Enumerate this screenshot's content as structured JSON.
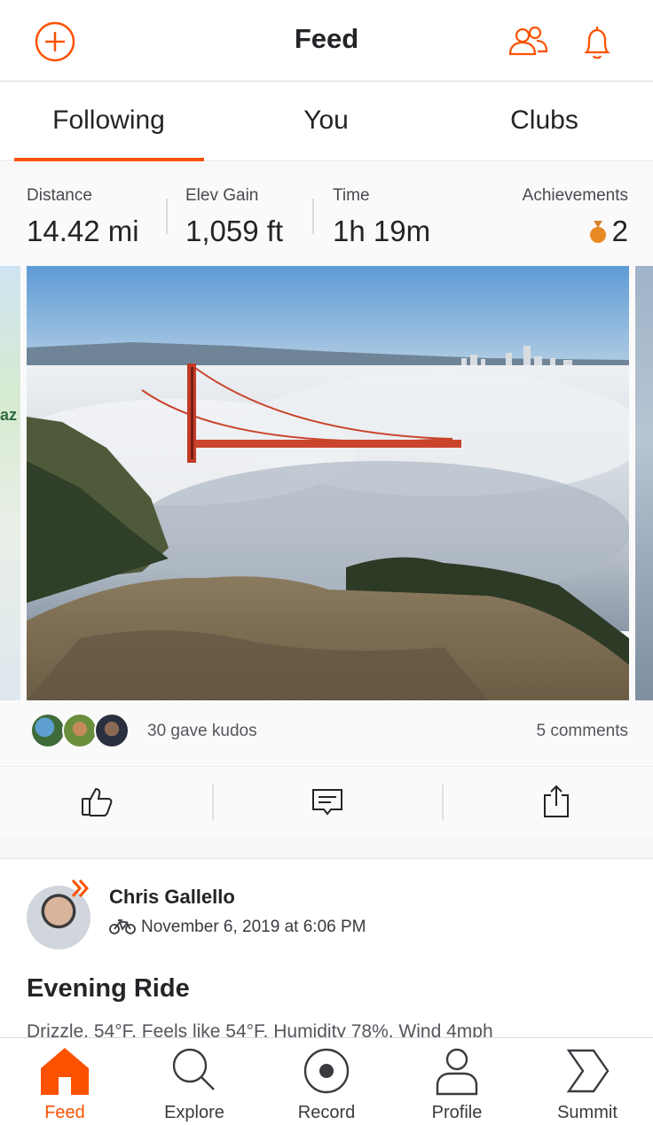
{
  "header": {
    "title": "Feed",
    "left_icon": "add-circle-icon",
    "right_icons": [
      "find-friends-icon",
      "notifications-bell-icon"
    ]
  },
  "tabs": [
    {
      "label": "Following",
      "active": true
    },
    {
      "label": "You",
      "active": false
    },
    {
      "label": "Clubs",
      "active": false
    }
  ],
  "activity": {
    "stats": [
      {
        "label": "Distance",
        "value": "14.42 mi"
      },
      {
        "label": "Elev Gain",
        "value": "1,059 ft"
      },
      {
        "label": "Time",
        "value": "1h 19m"
      }
    ],
    "achievements": {
      "label": "Achievements",
      "value": "2",
      "icon": "medal-icon"
    },
    "map_text": "az",
    "kudos_text": "30 gave kudos",
    "comments_text": "5 comments",
    "actions": [
      "kudos-thumbs-up-icon",
      "comment-icon",
      "share-icon"
    ]
  },
  "next_activity": {
    "athlete_name": "Chris Gallello",
    "date": "November 6, 2019 at 6:06 PM",
    "activity_type_icon": "bike-icon",
    "title": "Evening Ride",
    "description": "Drizzle, 54°F, Feels like 54°F, Humidity 78%, Wind 4mph"
  },
  "tabbar": [
    {
      "label": "Feed",
      "icon": "home-icon",
      "active": true
    },
    {
      "label": "Explore",
      "icon": "search-icon",
      "active": false
    },
    {
      "label": "Record",
      "icon": "record-icon",
      "active": false
    },
    {
      "label": "Profile",
      "icon": "profile-icon",
      "active": false
    },
    {
      "label": "Summit",
      "icon": "summit-icon",
      "active": false
    }
  ],
  "colors": {
    "accent": "#fc5200",
    "text": "#242428",
    "muted": "#55555c"
  }
}
